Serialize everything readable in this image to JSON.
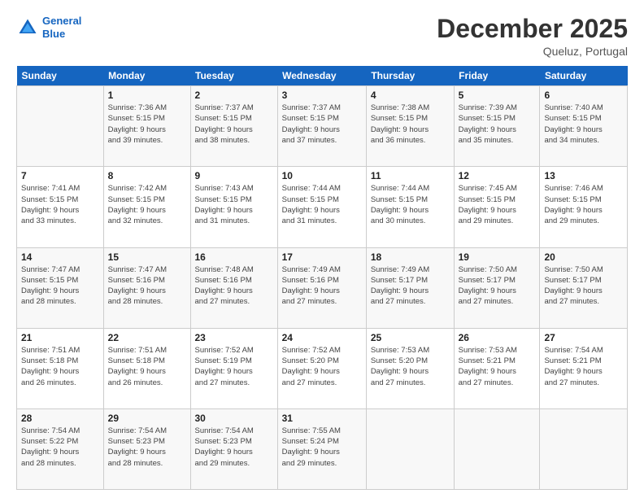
{
  "logo": {
    "line1": "General",
    "line2": "Blue"
  },
  "title": "December 2025",
  "location": "Queluz, Portugal",
  "header_days": [
    "Sunday",
    "Monday",
    "Tuesday",
    "Wednesday",
    "Thursday",
    "Friday",
    "Saturday"
  ],
  "weeks": [
    [
      {
        "day": "",
        "info": ""
      },
      {
        "day": "1",
        "info": "Sunrise: 7:36 AM\nSunset: 5:15 PM\nDaylight: 9 hours\nand 39 minutes."
      },
      {
        "day": "2",
        "info": "Sunrise: 7:37 AM\nSunset: 5:15 PM\nDaylight: 9 hours\nand 38 minutes."
      },
      {
        "day": "3",
        "info": "Sunrise: 7:37 AM\nSunset: 5:15 PM\nDaylight: 9 hours\nand 37 minutes."
      },
      {
        "day": "4",
        "info": "Sunrise: 7:38 AM\nSunset: 5:15 PM\nDaylight: 9 hours\nand 36 minutes."
      },
      {
        "day": "5",
        "info": "Sunrise: 7:39 AM\nSunset: 5:15 PM\nDaylight: 9 hours\nand 35 minutes."
      },
      {
        "day": "6",
        "info": "Sunrise: 7:40 AM\nSunset: 5:15 PM\nDaylight: 9 hours\nand 34 minutes."
      }
    ],
    [
      {
        "day": "7",
        "info": "Sunrise: 7:41 AM\nSunset: 5:15 PM\nDaylight: 9 hours\nand 33 minutes."
      },
      {
        "day": "8",
        "info": "Sunrise: 7:42 AM\nSunset: 5:15 PM\nDaylight: 9 hours\nand 32 minutes."
      },
      {
        "day": "9",
        "info": "Sunrise: 7:43 AM\nSunset: 5:15 PM\nDaylight: 9 hours\nand 31 minutes."
      },
      {
        "day": "10",
        "info": "Sunrise: 7:44 AM\nSunset: 5:15 PM\nDaylight: 9 hours\nand 31 minutes."
      },
      {
        "day": "11",
        "info": "Sunrise: 7:44 AM\nSunset: 5:15 PM\nDaylight: 9 hours\nand 30 minutes."
      },
      {
        "day": "12",
        "info": "Sunrise: 7:45 AM\nSunset: 5:15 PM\nDaylight: 9 hours\nand 29 minutes."
      },
      {
        "day": "13",
        "info": "Sunrise: 7:46 AM\nSunset: 5:15 PM\nDaylight: 9 hours\nand 29 minutes."
      }
    ],
    [
      {
        "day": "14",
        "info": "Sunrise: 7:47 AM\nSunset: 5:15 PM\nDaylight: 9 hours\nand 28 minutes."
      },
      {
        "day": "15",
        "info": "Sunrise: 7:47 AM\nSunset: 5:16 PM\nDaylight: 9 hours\nand 28 minutes."
      },
      {
        "day": "16",
        "info": "Sunrise: 7:48 AM\nSunset: 5:16 PM\nDaylight: 9 hours\nand 27 minutes."
      },
      {
        "day": "17",
        "info": "Sunrise: 7:49 AM\nSunset: 5:16 PM\nDaylight: 9 hours\nand 27 minutes."
      },
      {
        "day": "18",
        "info": "Sunrise: 7:49 AM\nSunset: 5:17 PM\nDaylight: 9 hours\nand 27 minutes."
      },
      {
        "day": "19",
        "info": "Sunrise: 7:50 AM\nSunset: 5:17 PM\nDaylight: 9 hours\nand 27 minutes."
      },
      {
        "day": "20",
        "info": "Sunrise: 7:50 AM\nSunset: 5:17 PM\nDaylight: 9 hours\nand 27 minutes."
      }
    ],
    [
      {
        "day": "21",
        "info": "Sunrise: 7:51 AM\nSunset: 5:18 PM\nDaylight: 9 hours\nand 26 minutes."
      },
      {
        "day": "22",
        "info": "Sunrise: 7:51 AM\nSunset: 5:18 PM\nDaylight: 9 hours\nand 26 minutes."
      },
      {
        "day": "23",
        "info": "Sunrise: 7:52 AM\nSunset: 5:19 PM\nDaylight: 9 hours\nand 27 minutes."
      },
      {
        "day": "24",
        "info": "Sunrise: 7:52 AM\nSunset: 5:20 PM\nDaylight: 9 hours\nand 27 minutes."
      },
      {
        "day": "25",
        "info": "Sunrise: 7:53 AM\nSunset: 5:20 PM\nDaylight: 9 hours\nand 27 minutes."
      },
      {
        "day": "26",
        "info": "Sunrise: 7:53 AM\nSunset: 5:21 PM\nDaylight: 9 hours\nand 27 minutes."
      },
      {
        "day": "27",
        "info": "Sunrise: 7:54 AM\nSunset: 5:21 PM\nDaylight: 9 hours\nand 27 minutes."
      }
    ],
    [
      {
        "day": "28",
        "info": "Sunrise: 7:54 AM\nSunset: 5:22 PM\nDaylight: 9 hours\nand 28 minutes."
      },
      {
        "day": "29",
        "info": "Sunrise: 7:54 AM\nSunset: 5:23 PM\nDaylight: 9 hours\nand 28 minutes."
      },
      {
        "day": "30",
        "info": "Sunrise: 7:54 AM\nSunset: 5:23 PM\nDaylight: 9 hours\nand 29 minutes."
      },
      {
        "day": "31",
        "info": "Sunrise: 7:55 AM\nSunset: 5:24 PM\nDaylight: 9 hours\nand 29 minutes."
      },
      {
        "day": "",
        "info": ""
      },
      {
        "day": "",
        "info": ""
      },
      {
        "day": "",
        "info": ""
      }
    ]
  ]
}
